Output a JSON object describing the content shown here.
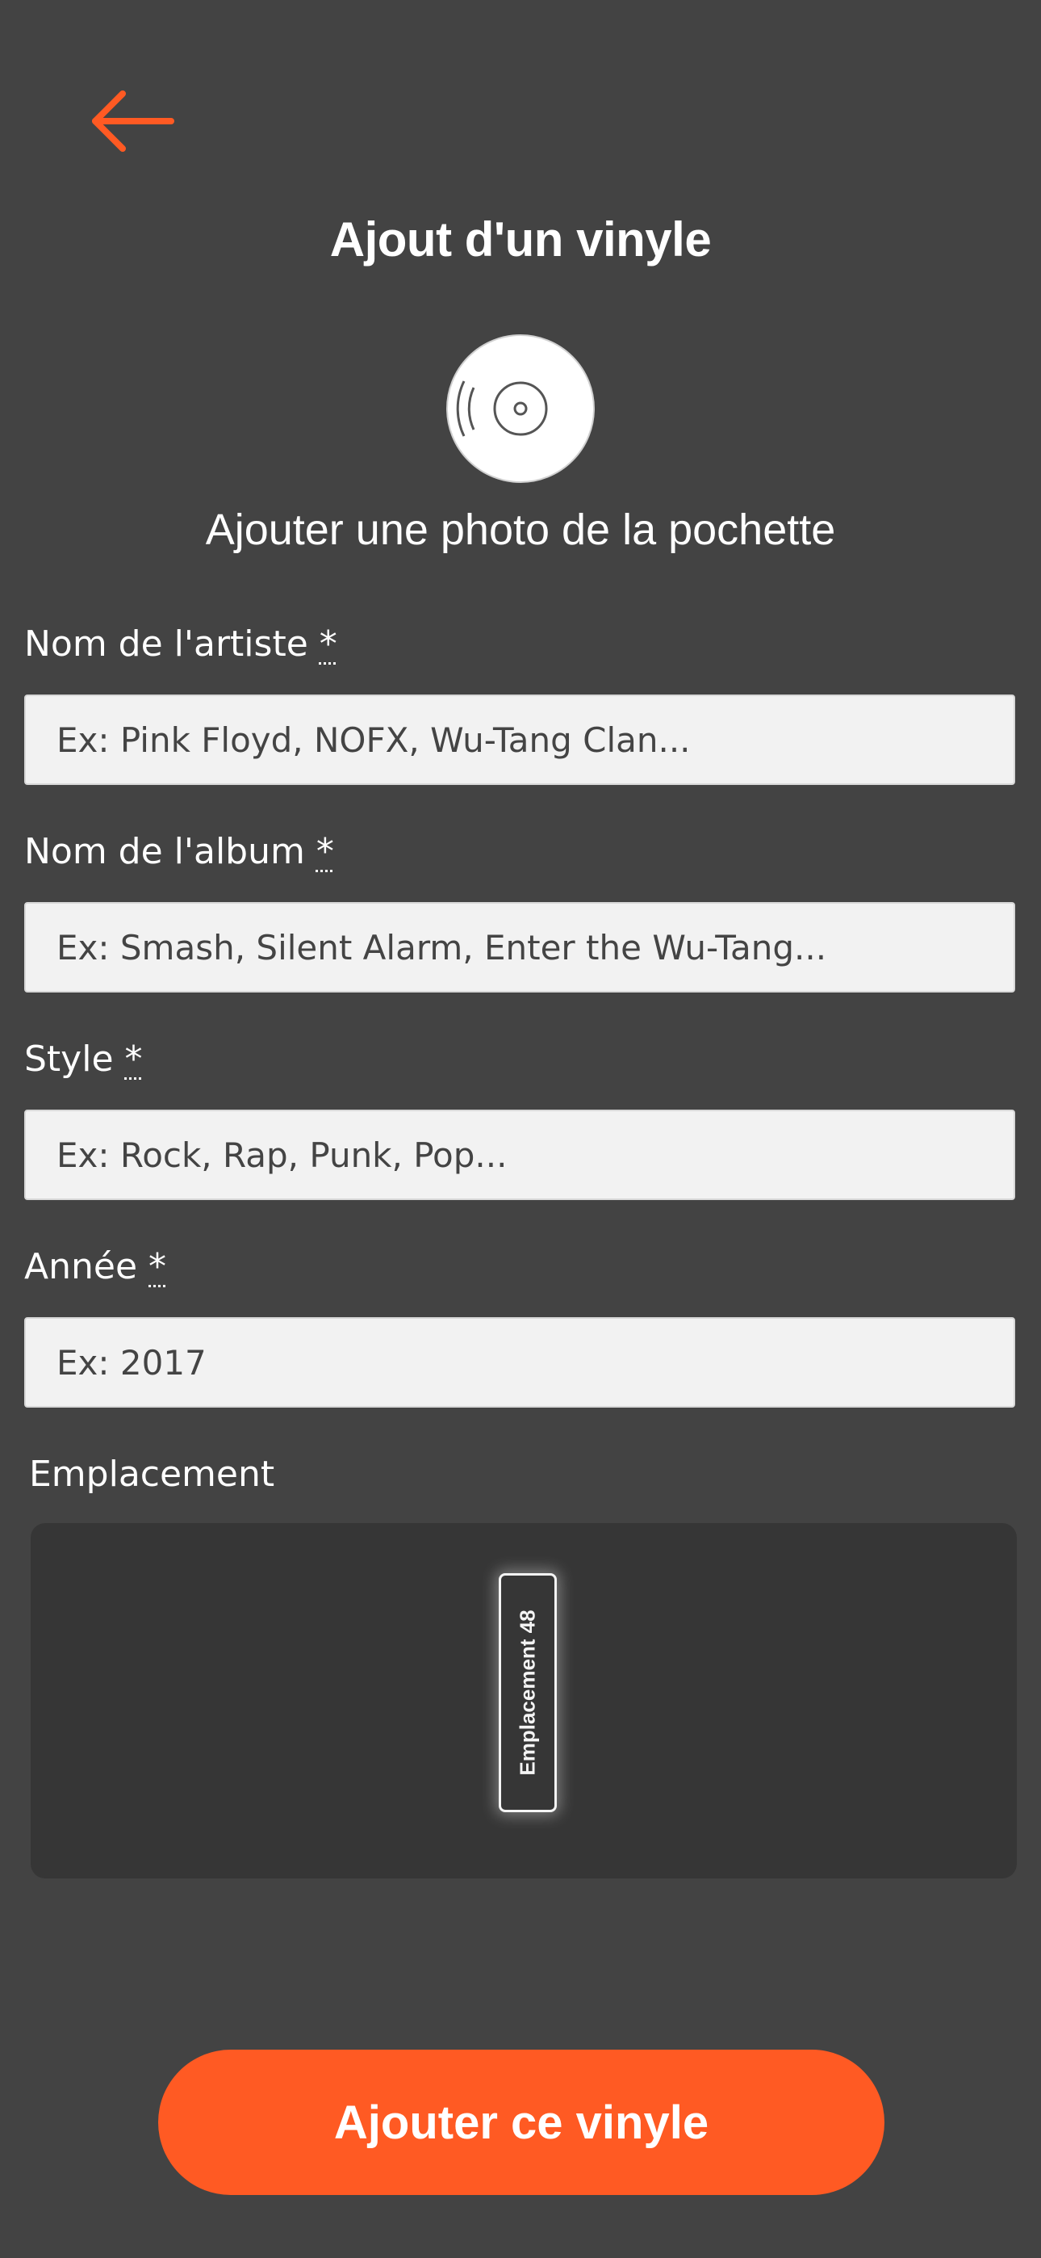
{
  "header": {
    "title": "Ajout d'un vinyle"
  },
  "cover": {
    "label": "Ajouter une photo de la pochette",
    "icon": "vinyl-record-icon"
  },
  "fields": {
    "artist": {
      "label": "Nom de l'artiste",
      "required_mark": "*",
      "placeholder": "Ex: Pink Floyd, NOFX, Wu-Tang Clan...",
      "value": ""
    },
    "album": {
      "label": "Nom de l'album",
      "required_mark": "*",
      "placeholder": "Ex: Smash, Silent Alarm, Enter the Wu-Tang...",
      "value": ""
    },
    "style": {
      "label": "Style",
      "required_mark": "*",
      "placeholder": "Ex: Rock, Rap, Punk, Pop...",
      "value": ""
    },
    "year": {
      "label": "Année",
      "required_mark": "*",
      "placeholder": "Ex: 2017",
      "value": ""
    }
  },
  "location": {
    "label": "Emplacement",
    "slot_label": "Emplacement 48"
  },
  "actions": {
    "submit_label": "Ajouter ce vinyle"
  },
  "colors": {
    "accent": "#ff5a23",
    "background": "#434343",
    "input_bg": "#f2f2f2",
    "map_bg": "#363636"
  }
}
